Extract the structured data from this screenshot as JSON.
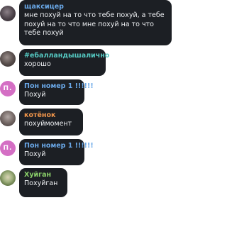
{
  "colors": {
    "bubble_bg": "#1c1f24",
    "text": "#eef0f3",
    "sender_blue": "#6aa8e8",
    "sender_teal": "#54c7c0",
    "sender_orange": "#f0954a",
    "sender_green": "#8bd16a",
    "avatar_pink": "#d46fc4"
  },
  "messages": [
    {
      "sender": "щаксицер",
      "text": "мне похуй на то что тебе похуй, а тебе похуй на то что мне похуй на то что тебе похуй"
    },
    {
      "sender": "#ебалландышалично",
      "text": "хорошо"
    },
    {
      "sender": "Пон номер 1 !!!!!!",
      "avatar_initials": "П.",
      "text": "Похуй"
    },
    {
      "sender": "котёнок",
      "text": "похуймомент"
    },
    {
      "sender": "Пон номер 1 !!!!!!",
      "avatar_initials": "П.",
      "text": "Похуй"
    },
    {
      "sender": "Хуйган",
      "text": "Похуйган"
    }
  ]
}
